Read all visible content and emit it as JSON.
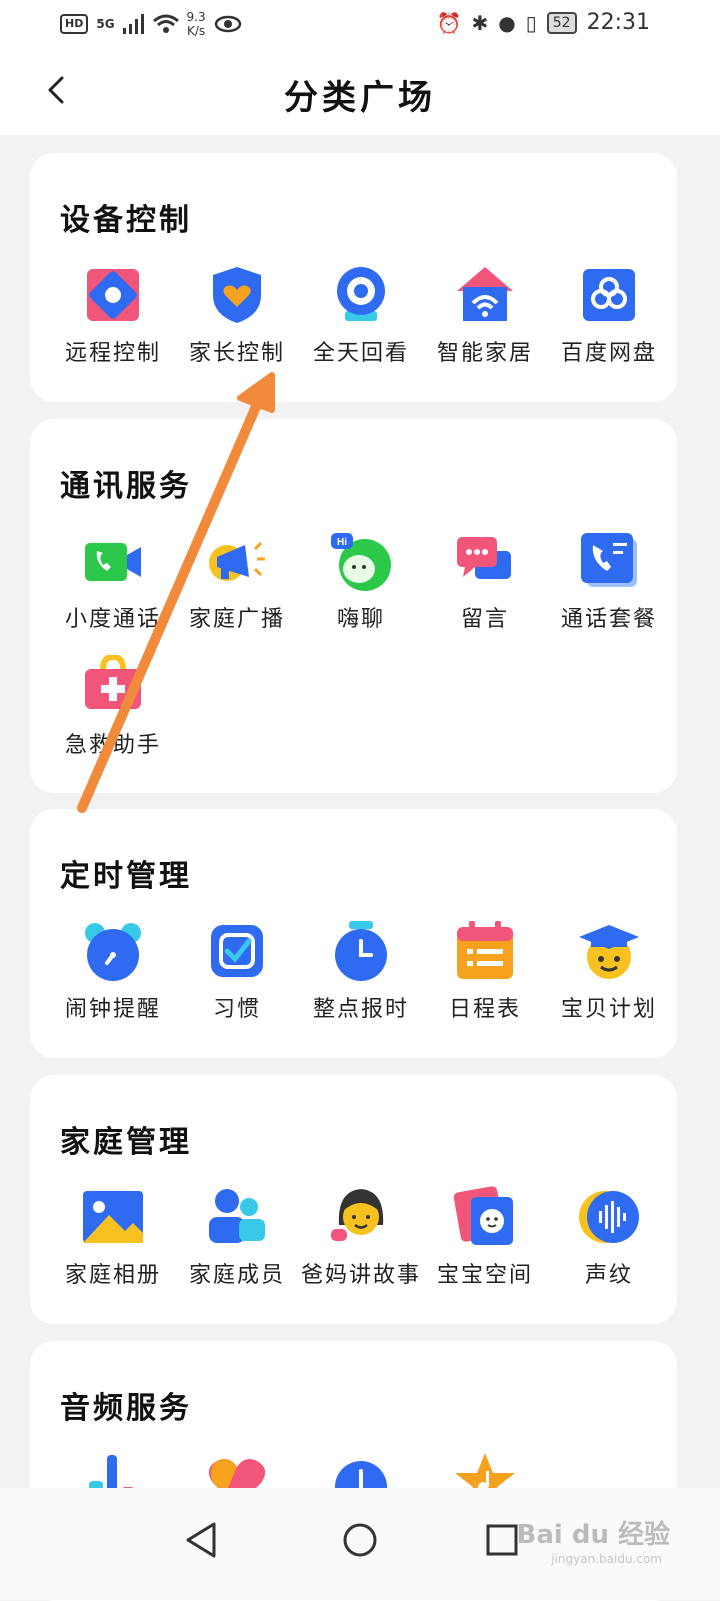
{
  "status_bar": {
    "hd": "HD",
    "network": "5G",
    "speed_value": "9.3",
    "speed_unit": "K/s",
    "battery": "52",
    "time": "22:31"
  },
  "header": {
    "title": "分类广场"
  },
  "sections": [
    {
      "title": "设备控制",
      "items": [
        "远程控制",
        "家长控制",
        "全天回看",
        "智能家居",
        "百度网盘"
      ]
    },
    {
      "title": "通讯服务",
      "items": [
        "小度通话",
        "家庭广播",
        "嗨聊",
        "留言",
        "通话套餐",
        "急救助手"
      ]
    },
    {
      "title": "定时管理",
      "items": [
        "闹钟提醒",
        "习惯",
        "整点报时",
        "日程表",
        "宝贝计划"
      ]
    },
    {
      "title": "家庭管理",
      "items": [
        "家庭相册",
        "家庭成员",
        "爸妈讲故事",
        "宝宝空间",
        "声纹"
      ]
    },
    {
      "title": "音频服务",
      "items": []
    }
  ],
  "watermark": {
    "main": "Bai du 经验",
    "sub": "jingyan.baidu.com"
  },
  "colors": {
    "accent_blue": "#2f6bf0",
    "arrow_orange": "#f28a3c",
    "pink": "#f2557a",
    "yellow": "#f7c21f"
  }
}
